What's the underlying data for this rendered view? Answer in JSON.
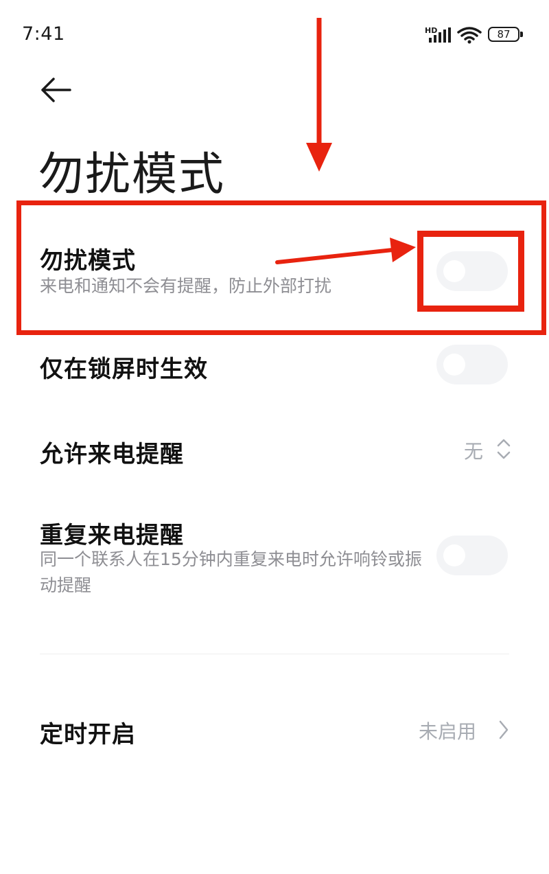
{
  "status_bar": {
    "time": "7:41",
    "network_badge": "HD",
    "battery_level": "87",
    "icons": [
      "signal-icon",
      "wifi-icon",
      "battery-icon"
    ]
  },
  "header": {
    "back_icon": "back-arrow-icon",
    "title": "勿扰模式"
  },
  "settings": {
    "dnd": {
      "title": "勿扰模式",
      "subtitle": "来电和通知不会有提醒，防止外部打扰",
      "toggle_on": false
    },
    "lock_only": {
      "title": "仅在锁屏时生效",
      "toggle_on": false
    },
    "allow_calls": {
      "title": "允许来电提醒",
      "value": "无"
    },
    "repeat_calls": {
      "title": "重复来电提醒",
      "subtitle": "同一个联系人在15分钟内重复来电时允许响铃或振动提醒",
      "toggle_on": false
    },
    "schedule": {
      "title": "定时开启",
      "value": "未启用"
    }
  },
  "colors": {
    "annotation": "#e8230f",
    "toggle_off": "#f3f4f6",
    "secondary_text": "#8e8e93",
    "value_text": "#a8acb3"
  }
}
